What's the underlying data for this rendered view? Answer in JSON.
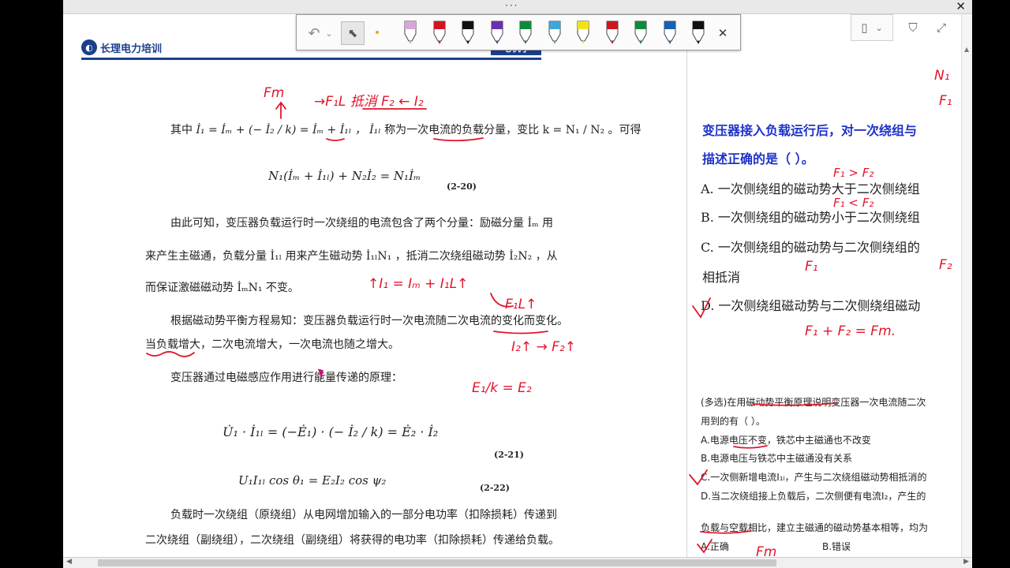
{
  "window": {
    "topbar_dots": "···",
    "close_glyph": "✕"
  },
  "toolbar": {
    "undo_glyph": "↶",
    "undo_drop": "⌄",
    "select_glyph": "⬉",
    "dot_glyph": "•",
    "close_glyph": "✕",
    "pens": [
      {
        "name": "pen-pink",
        "color": "#d9a6d6"
      },
      {
        "name": "pen-red",
        "color": "#d2141e"
      },
      {
        "name": "pen-black",
        "color": "#111111"
      },
      {
        "name": "pen-purple",
        "color": "#6a2fb0"
      },
      {
        "name": "pen-green",
        "color": "#0f8a3c"
      },
      {
        "name": "pen-light-blue",
        "color": "#3fa6d8"
      },
      {
        "name": "pen-yellow",
        "color": "#f2e21a"
      },
      {
        "name": "pen-red-fine",
        "color": "#d2141e"
      },
      {
        "name": "pen-green-fine",
        "color": "#0f8a3c"
      },
      {
        "name": "pen-blue-fine",
        "color": "#1a5fb4"
      },
      {
        "name": "pen-black-fine",
        "color": "#111111"
      }
    ]
  },
  "right_tools": {
    "page_glyph": "▯",
    "chevron_glyph": "⌄",
    "filter_glyph": "⛉",
    "expand_glyph": "⤢"
  },
  "doc": {
    "brand": "长理电力培训",
    "section_tag": "电机学",
    "line1_pre": "其中",
    "line1_formula": "İ₁ = İₘ + (− İ₂ / k) = İₘ + İ₁ₗ ，",
    "line1_il": "İ₁ₗ",
    "line1_mid": " 称为一次电流的",
    "line1_term": "负载分量",
    "line1_ratio": "，变比 k = N₁ / N₂ 。可得",
    "eq_2_20": "N₁(İₘ + İ₁ₗ) + N₂İ₂ = N₁İₘ",
    "eq_2_20_no": "(2-20)",
    "p1_line1": "由此可知，变压器负载运行时一次绕组的电流包含了两个分量：励磁分量 İₘ 用",
    "p1_line2": "来产生主磁通，负载分量 İ₁ₗ 用来产生磁动势 İ₁ₗN₁ ，抵消二次绕组磁动势 İ₂N₂ ，从",
    "p1_line3": "而保证激磁磁动势 İₘN₁ 不变。",
    "p2_line1": "根据磁动势平衡方程易知：变压器负载运行时一次电流随二次电流的变化而变化。",
    "p2_line2": "当负载增大，二次电流增大，一次电流也随之增大。",
    "p3_line1": "变压器通过电磁感应作用进行能量传递的原理：",
    "eq_2_21": "U̇₁ · İ₁ₗ = (−Ė₁) · (− İ₂ / k) = Ė₂ · İ₂",
    "eq_2_21_no": "(2-21)",
    "eq_2_22": "U₁I₁ₗ cos θ₁ = E₂I₂ cos ψ₂",
    "eq_2_22_no": "(2-22)",
    "p4_line1": "负载时一次绕组（原绕组）从电网增加输入的一部分电功率（扣除损耗）传递到",
    "p4_line2": "二次绕组（副绕组），二次绕组（副绕组）将获得的电功率（扣除损耗）传递给负载。"
  },
  "question": {
    "stem_line1": "变压器接入负载运行后，对一次绕组与",
    "stem_line2": "描述正确的是（     ）。",
    "opt_a": "A. 一次侧绕组的磁动势大于二次侧绕组",
    "opt_b": "B. 一次侧绕组的磁动势小于二次侧绕组",
    "opt_c": "C. 一次侧绕组的磁动势与二次侧绕组的",
    "opt_c2": "相抵消",
    "opt_d": "D. 一次侧绕组磁动势与二次侧绕组磁动"
  },
  "multi": {
    "stem_line1": "(多选)在用磁动势平衡原理说明变压器一次电流随二次",
    "stem_line2": "用到的有（  ）。",
    "opt_a": "A.电源电压不变，铁芯中主磁通也不改变",
    "opt_b": "B.电源电压与铁芯中主磁通没有关系",
    "opt_c": "C.一次侧新增电流I₁ₗ，产生与二次绕组磁动势相抵消的",
    "opt_d": "D.当二次绕组接上负载后，二次侧便有电流I₂，产生的",
    "tf_stem": "负载与空载相比，建立主磁通的磁动势基本相等，均为",
    "tf_a": "A.正确",
    "tf_b": "B.错误"
  },
  "ink": {
    "fm_top": "Fm",
    "fl_label": "→F₁L 抵消 F₂ ← I₂",
    "i1_eq": "↑I₁ = Iₘ + I₁L↑",
    "f1l_up": "F₁L↑",
    "i2_f2": "I₂↑ → F₂↑",
    "e1k": "E₁/k = E₂",
    "f1_gt": "F₁ > F₂",
    "f1_lt": "F₁ < F₂",
    "f1_c": "F₁",
    "f2_c": "F₂",
    "f_sum": "F₁ + F₂ = Fm.",
    "n1_corner": "N₁",
    "f1_corner": "F₁",
    "fm_bottom": "Fm"
  }
}
